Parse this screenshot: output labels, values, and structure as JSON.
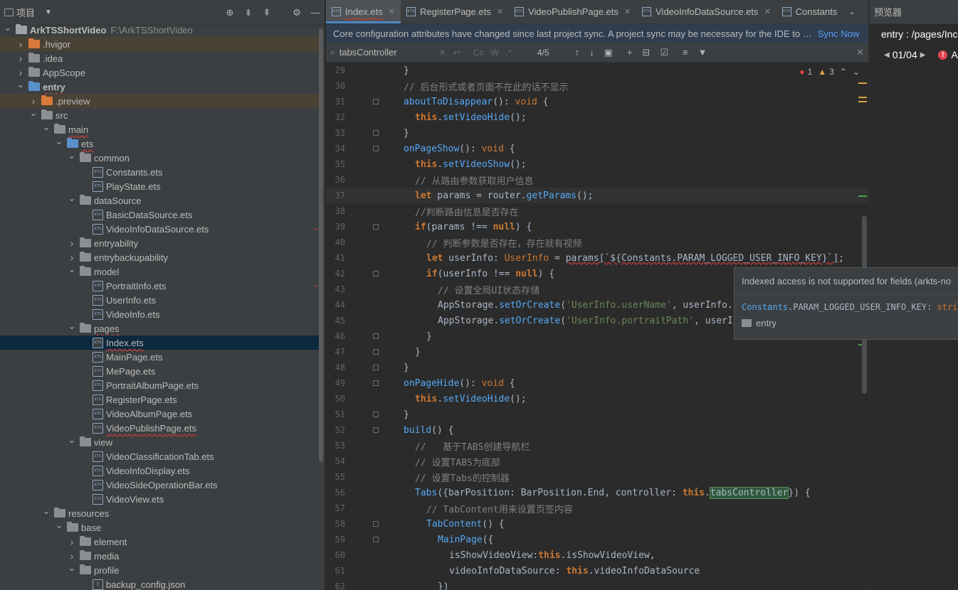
{
  "project_panel": {
    "title": "项目",
    "tree": [
      {
        "label": "ArkTSShortVideo",
        "path": "F:\\ArkTSShortVideo",
        "depth": 0,
        "arrow": "open",
        "icon": "folder-root",
        "bold": true
      },
      {
        "label": ".hvigor",
        "depth": 1,
        "arrow": "closed",
        "icon": "folder-orange",
        "hl": "orange"
      },
      {
        "label": ".idea",
        "depth": 1,
        "arrow": "closed",
        "icon": "folder"
      },
      {
        "label": "AppScope",
        "depth": 1,
        "arrow": "closed",
        "icon": "folder"
      },
      {
        "label": "entry",
        "depth": 1,
        "arrow": "open",
        "icon": "folder-blue",
        "bold": true,
        "wavy": true
      },
      {
        "label": ".preview",
        "depth": 2,
        "arrow": "closed",
        "icon": "folder-orange",
        "hl": "orange"
      },
      {
        "label": "src",
        "depth": 2,
        "arrow": "open",
        "icon": "folder"
      },
      {
        "label": "main",
        "depth": 3,
        "arrow": "open",
        "icon": "folder",
        "wavy": true
      },
      {
        "label": "ets",
        "depth": 4,
        "arrow": "open",
        "icon": "folder-blue",
        "wavy": true
      },
      {
        "label": "common",
        "depth": 5,
        "arrow": "open",
        "icon": "folder"
      },
      {
        "label": "Constants.ets",
        "depth": 6,
        "icon": "file"
      },
      {
        "label": "PlayState.ets",
        "depth": 6,
        "icon": "file"
      },
      {
        "label": "dataSource",
        "depth": 5,
        "arrow": "open",
        "icon": "folder"
      },
      {
        "label": "BasicDataSource.ets",
        "depth": 6,
        "icon": "file"
      },
      {
        "label": "VideoInfoDataSource.ets",
        "depth": 6,
        "icon": "file",
        "err": true
      },
      {
        "label": "entryability",
        "depth": 5,
        "arrow": "closed",
        "icon": "folder"
      },
      {
        "label": "entrybackupability",
        "depth": 5,
        "arrow": "closed",
        "icon": "folder"
      },
      {
        "label": "model",
        "depth": 5,
        "arrow": "open",
        "icon": "folder"
      },
      {
        "label": "PortraitInfo.ets",
        "depth": 6,
        "icon": "file",
        "err": true
      },
      {
        "label": "UserInfo.ets",
        "depth": 6,
        "icon": "file"
      },
      {
        "label": "VideoInfo.ets",
        "depth": 6,
        "icon": "file"
      },
      {
        "label": "pages",
        "depth": 5,
        "arrow": "open",
        "icon": "folder",
        "wavy": true
      },
      {
        "label": "Index.ets",
        "depth": 6,
        "icon": "file",
        "selected": true,
        "wavy": true
      },
      {
        "label": "MainPage.ets",
        "depth": 6,
        "icon": "file"
      },
      {
        "label": "MePage.ets",
        "depth": 6,
        "icon": "file"
      },
      {
        "label": "PortraitAlbumPage.ets",
        "depth": 6,
        "icon": "file"
      },
      {
        "label": "RegisterPage.ets",
        "depth": 6,
        "icon": "file"
      },
      {
        "label": "VideoAlbumPage.ets",
        "depth": 6,
        "icon": "file"
      },
      {
        "label": "VideoPublishPage.ets",
        "depth": 6,
        "icon": "file",
        "wavy": true
      },
      {
        "label": "view",
        "depth": 5,
        "arrow": "open",
        "icon": "folder"
      },
      {
        "label": "VideoClassificationTab.ets",
        "depth": 6,
        "icon": "file"
      },
      {
        "label": "VideoInfoDisplay.ets",
        "depth": 6,
        "icon": "file"
      },
      {
        "label": "VideoSideOperationBar.ets",
        "depth": 6,
        "icon": "file"
      },
      {
        "label": "VideoView.ets",
        "depth": 6,
        "icon": "file"
      },
      {
        "label": "resources",
        "depth": 3,
        "arrow": "open",
        "icon": "folder"
      },
      {
        "label": "base",
        "depth": 4,
        "arrow": "open",
        "icon": "folder"
      },
      {
        "label": "element",
        "depth": 5,
        "arrow": "closed",
        "icon": "folder"
      },
      {
        "label": "media",
        "depth": 5,
        "arrow": "closed",
        "icon": "folder"
      },
      {
        "label": "profile",
        "depth": 5,
        "arrow": "open",
        "icon": "folder"
      },
      {
        "label": "backup_config.json",
        "depth": 6,
        "icon": "file-json"
      }
    ]
  },
  "tabs": [
    {
      "label": "Index.ets",
      "active": true
    },
    {
      "label": "RegisterPage.ets"
    },
    {
      "label": "VideoPublishPage.ets"
    },
    {
      "label": "VideoInfoDataSource.ets"
    },
    {
      "label": "Constants",
      "truncated": true
    }
  ],
  "sync_banner": {
    "message": "Core configuration attributes have changed since last project sync. A project sync may be necessary for the IDE to …",
    "action": "Sync Now"
  },
  "search": {
    "query": "tabsController",
    "option_cc": "Cc",
    "option_w": "W",
    "option_regex": ".*",
    "count": "4/5"
  },
  "inspections": {
    "errors": "1",
    "warnings": "3"
  },
  "code_lines": [
    {
      "n": "29",
      "indent": 2,
      "tokens": [
        [
          "}",
          "var"
        ]
      ]
    },
    {
      "n": "30",
      "indent": 2,
      "tokens": [
        [
          "// 后台形式或者页面不在此的话不显示",
          "com"
        ]
      ]
    },
    {
      "n": "31",
      "indent": 2,
      "fold": true,
      "tokens": [
        [
          "aboutToDisappear",
          "call"
        ],
        [
          "(): ",
          "var"
        ],
        [
          "void",
          "kw"
        ],
        [
          " {",
          "var"
        ]
      ]
    },
    {
      "n": "32",
      "indent": 4,
      "tokens": [
        [
          "this",
          "this"
        ],
        [
          ".",
          "var"
        ],
        [
          "setVideoHide",
          "call"
        ],
        [
          "();",
          "var"
        ]
      ]
    },
    {
      "n": "33",
      "indent": 2,
      "fold": true,
      "tokens": [
        [
          "}",
          "var"
        ]
      ]
    },
    {
      "n": "34",
      "indent": 2,
      "fold": true,
      "tokens": [
        [
          "onPageShow",
          "call"
        ],
        [
          "(): ",
          "var"
        ],
        [
          "void",
          "kw"
        ],
        [
          " {",
          "var"
        ]
      ]
    },
    {
      "n": "35",
      "indent": 4,
      "tokens": [
        [
          "this",
          "this"
        ],
        [
          ".",
          "var"
        ],
        [
          "setVideoShow",
          "call"
        ],
        [
          "();",
          "var"
        ]
      ]
    },
    {
      "n": "36",
      "indent": 4,
      "tokens": [
        [
          "// 从路由参数获取用户信息",
          "com"
        ]
      ]
    },
    {
      "n": "37",
      "indent": 4,
      "current": true,
      "tokens": [
        [
          "let",
          "kwb"
        ],
        [
          " params = router.",
          "var"
        ],
        [
          "getParams",
          "call"
        ],
        [
          "();",
          "var"
        ]
      ]
    },
    {
      "n": "38",
      "indent": 4,
      "tokens": [
        [
          "//判断路由信息是否存在",
          "com"
        ]
      ]
    },
    {
      "n": "39",
      "indent": 4,
      "fold": true,
      "tokens": [
        [
          "if",
          "kwb"
        ],
        [
          "(params !== ",
          "var"
        ],
        [
          "null",
          "kwb"
        ],
        [
          ") {",
          "var"
        ]
      ]
    },
    {
      "n": "40",
      "indent": 6,
      "tokens": [
        [
          "// 判断参数是否存在，存在就有视频",
          "com"
        ]
      ]
    },
    {
      "n": "41",
      "indent": 6,
      "tokens": [
        [
          "let",
          "kwb"
        ],
        [
          " userInfo: ",
          "var"
        ],
        [
          "UserInfo",
          "kw"
        ],
        [
          " = ",
          "var"
        ],
        [
          "params[`${Constants.PARAM_LOGGED_USER_INFO_KEY}`]",
          "tmpl"
        ],
        [
          ";",
          "var"
        ]
      ]
    },
    {
      "n": "42",
      "indent": 6,
      "fold": true,
      "tokens": [
        [
          "if",
          "kwb"
        ],
        [
          "(userInfo !== ",
          "var"
        ],
        [
          "null",
          "kwb"
        ],
        [
          ") {",
          "var"
        ]
      ]
    },
    {
      "n": "43",
      "indent": 8,
      "tokens": [
        [
          "// 设置全局UI状态存储",
          "com"
        ]
      ]
    },
    {
      "n": "44",
      "indent": 8,
      "tokens": [
        [
          "AppStorage.",
          "var"
        ],
        [
          "setOrCreate",
          "call"
        ],
        [
          "(",
          "var"
        ],
        [
          "'UserInfo.userName'",
          "str"
        ],
        [
          ", userInfo.u",
          "var"
        ]
      ]
    },
    {
      "n": "45",
      "indent": 8,
      "tokens": [
        [
          "AppStorage.",
          "var"
        ],
        [
          "setOrCreate",
          "call"
        ],
        [
          "(",
          "var"
        ],
        [
          "'UserInfo.portraitPath'",
          "str"
        ],
        [
          ", userIn",
          "var"
        ]
      ]
    },
    {
      "n": "46",
      "indent": 6,
      "fold": true,
      "tokens": [
        [
          "}",
          "var"
        ]
      ]
    },
    {
      "n": "47",
      "indent": 4,
      "fold": true,
      "tokens": [
        [
          "}",
          "var"
        ]
      ]
    },
    {
      "n": "48",
      "indent": 2,
      "fold": true,
      "tokens": [
        [
          "}",
          "var"
        ]
      ]
    },
    {
      "n": "49",
      "indent": 2,
      "fold": true,
      "tokens": [
        [
          "onPageHide",
          "call"
        ],
        [
          "(): ",
          "var"
        ],
        [
          "void",
          "kw"
        ],
        [
          " {",
          "var"
        ]
      ]
    },
    {
      "n": "50",
      "indent": 4,
      "tokens": [
        [
          "this",
          "this"
        ],
        [
          ".",
          "var"
        ],
        [
          "setVideoHide",
          "call"
        ],
        [
          "();",
          "var"
        ]
      ]
    },
    {
      "n": "51",
      "indent": 2,
      "fold": true,
      "tokens": [
        [
          "}",
          "var"
        ]
      ]
    },
    {
      "n": "52",
      "indent": 2,
      "fold": true,
      "tokens": [
        [
          "build",
          "call"
        ],
        [
          "() {",
          "var"
        ]
      ]
    },
    {
      "n": "53",
      "indent": 4,
      "tokens": [
        [
          "//   基于TABS创建导航栏",
          "com"
        ]
      ]
    },
    {
      "n": "54",
      "indent": 4,
      "tokens": [
        [
          "// 设置TABS为底部",
          "com"
        ]
      ]
    },
    {
      "n": "55",
      "indent": 4,
      "tokens": [
        [
          "// 设置Tabs的控制器",
          "com"
        ]
      ]
    },
    {
      "n": "56",
      "indent": 4,
      "tokens": [
        [
          "Tabs",
          "call"
        ],
        [
          "({barPosition: BarPosition.End, controller: ",
          "var"
        ],
        [
          "this",
          "this"
        ],
        [
          ".",
          "var"
        ],
        [
          "tabsController",
          "hl"
        ],
        [
          "}) {",
          "var"
        ]
      ]
    },
    {
      "n": "57",
      "indent": 6,
      "tokens": [
        [
          "// TabContent用来设置页签内容",
          "com"
        ]
      ]
    },
    {
      "n": "58",
      "indent": 6,
      "fold": true,
      "tokens": [
        [
          "TabContent",
          "call"
        ],
        [
          "() {",
          "var"
        ]
      ]
    },
    {
      "n": "59",
      "indent": 8,
      "fold": true,
      "tokens": [
        [
          "MainPage",
          "call"
        ],
        [
          "({",
          "var"
        ]
      ]
    },
    {
      "n": "60",
      "indent": 10,
      "tokens": [
        [
          "isShowVideoView:",
          "var"
        ],
        [
          "this",
          "this"
        ],
        [
          ".isShowVideoView,",
          "var"
        ]
      ]
    },
    {
      "n": "61",
      "indent": 10,
      "tokens": [
        [
          "videoInfoDataSource: ",
          "var"
        ],
        [
          "this",
          "this"
        ],
        [
          ".videoInfoDataSource",
          "var"
        ]
      ]
    },
    {
      "n": "62",
      "indent": 8,
      "tokens": [
        [
          "})",
          "var"
        ]
      ]
    }
  ],
  "tooltip": {
    "message": "Indexed access is not supported for fields (arkts-no",
    "signature_class": "Constants",
    "signature_field": ".PARAM_LOGGED_USER_INFO_KEY: ",
    "signature_type": "string",
    "module": "entry"
  },
  "preview": {
    "title": "预览器",
    "route": "entry : /pages/Inc",
    "page_counter": "01/04",
    "error_label": "A"
  }
}
